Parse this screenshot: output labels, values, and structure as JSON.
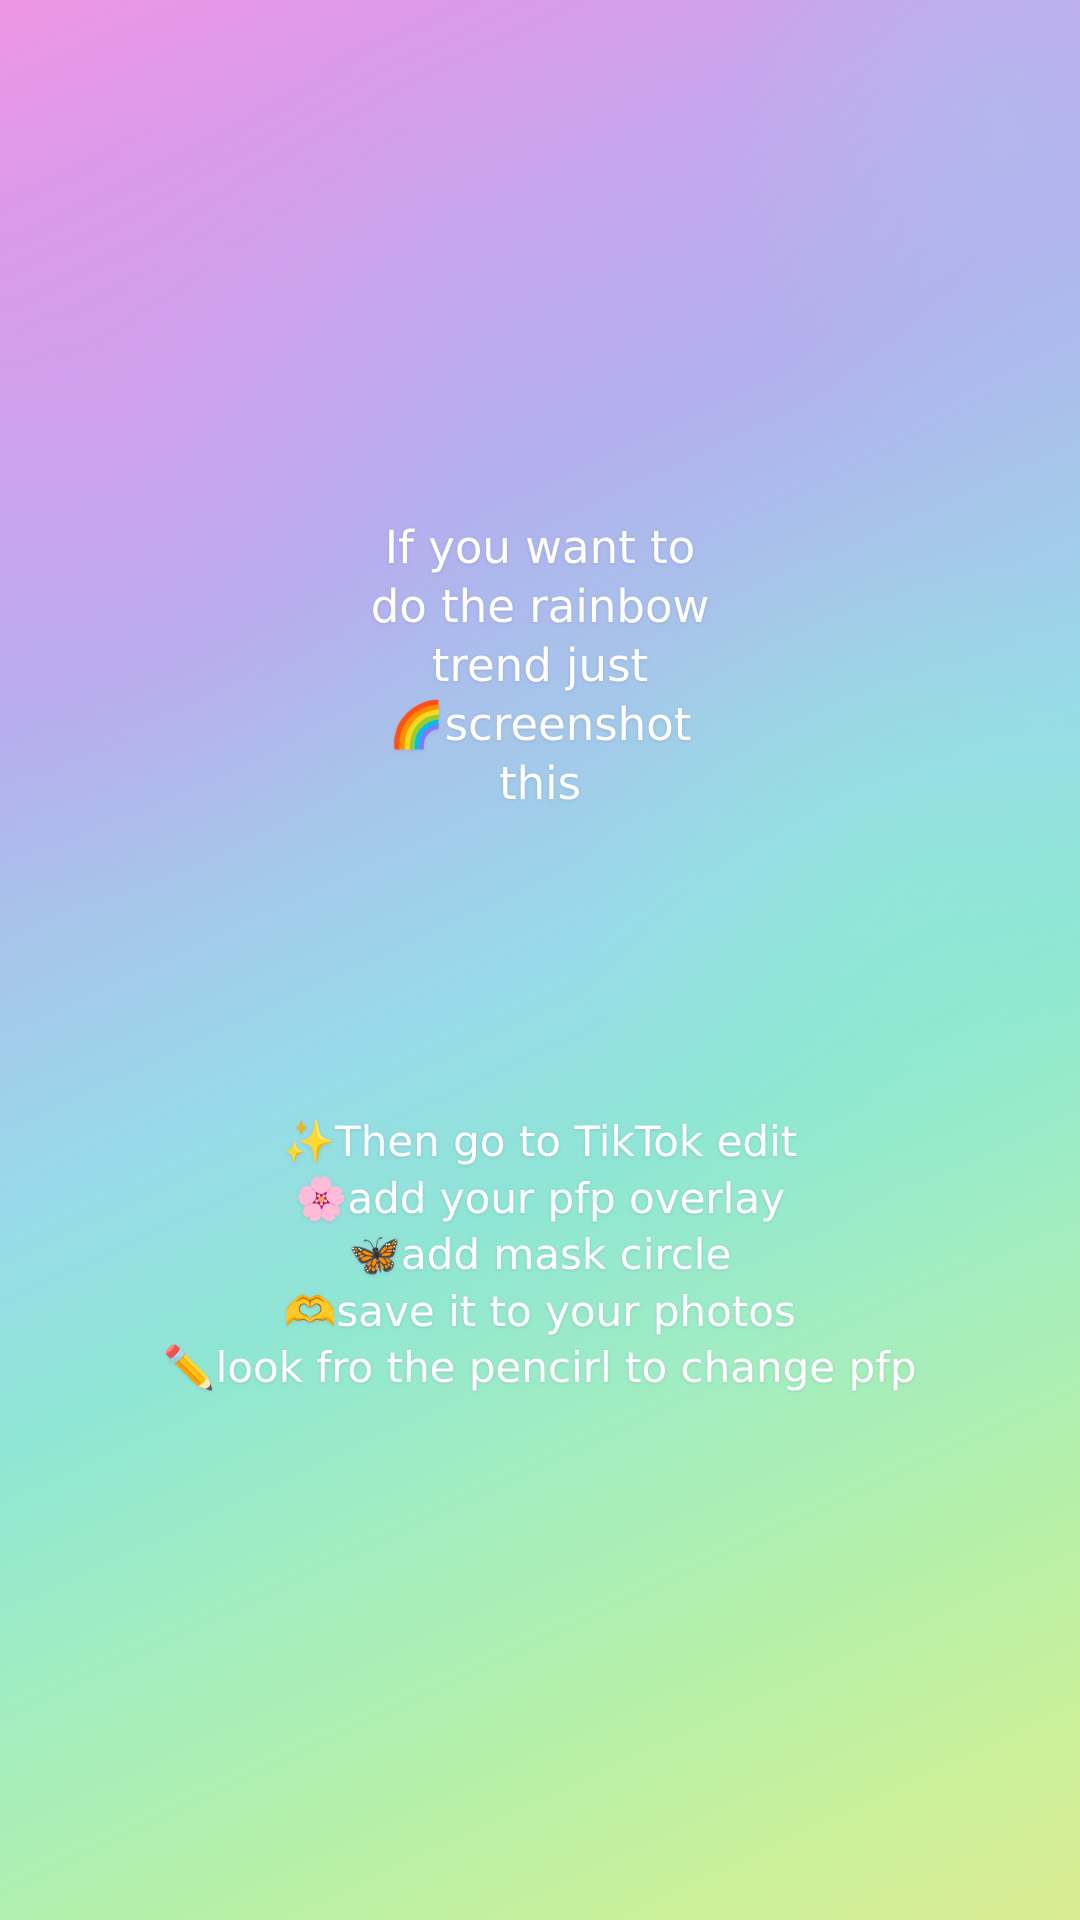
{
  "background": {
    "colors": [
      "#ee96e4",
      "#c4a7ef",
      "#98daea",
      "#8fe6d4",
      "#b5f0a9",
      "#d9ea92"
    ]
  },
  "intro": {
    "lines": [
      "If you want to",
      "do the rainbow",
      "trend just",
      "🌈screenshot",
      "this"
    ]
  },
  "steps": {
    "lines": [
      "✨Then go to TikTok edit",
      "🌸add your pfp overlay",
      "🦋add mask circle",
      "🫶save it to your photos",
      "✏️look fro the pencirl to change pfp"
    ]
  }
}
